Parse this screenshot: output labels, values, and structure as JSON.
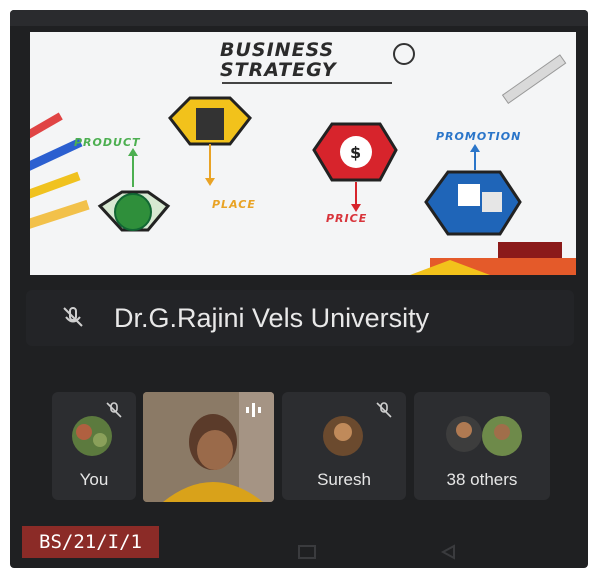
{
  "slide": {
    "heading_line1": "BUSINESS",
    "heading_line2": "STRATEGY",
    "items": [
      {
        "label": "PRODUCT",
        "color": "#4caf50"
      },
      {
        "label": "PLACE",
        "color": "#e9a325"
      },
      {
        "label": "PRICE",
        "color": "#d8343b"
      },
      {
        "label": "PROMOTION",
        "color": "#2a75c9"
      }
    ],
    "accent_colors": {
      "product": "#2f8f3b",
      "place": "#f2c21b",
      "price": "#d7242c",
      "promotion": "#1f65b8"
    }
  },
  "presenter": {
    "name": "Dr.G.Rajini Vels University",
    "mic_state": "muted"
  },
  "participants": [
    {
      "label": "You",
      "mic_icon": "mic-off-icon"
    },
    {
      "label": "",
      "mic_icon": "audio-level-icon"
    },
    {
      "label": "Suresh",
      "mic_icon": "mic-off-icon"
    },
    {
      "label": "38 others",
      "mic_icon": ""
    }
  ],
  "badge": {
    "text": "BS/21/I/1"
  },
  "nav": {
    "icons": [
      "recent-apps-icon",
      "back-icon"
    ]
  }
}
